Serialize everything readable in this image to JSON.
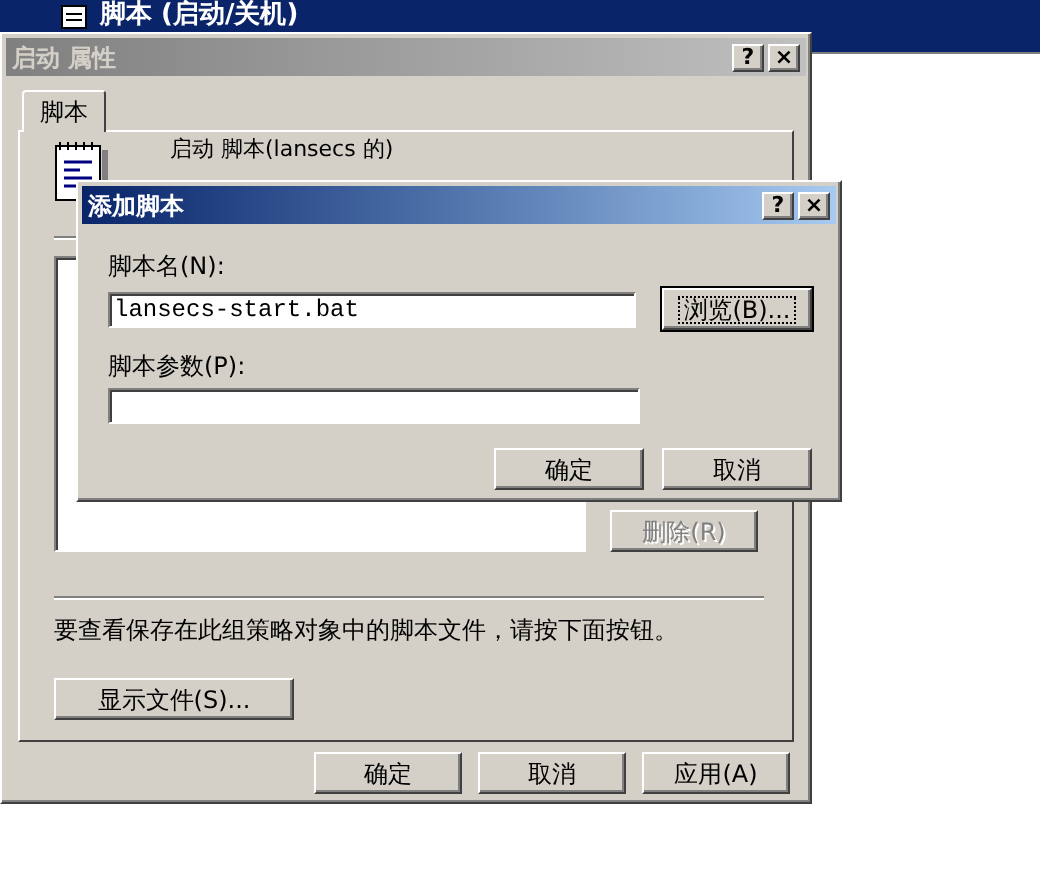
{
  "background_window": {
    "title": "脚本 (启动/关机)"
  },
  "properties_dialog": {
    "title": "启动 属性",
    "active": false,
    "title_buttons": [
      "?",
      "×"
    ],
    "tabs": [
      {
        "label": "脚本",
        "selected": true
      }
    ],
    "heading": "启动 脚本(lansecs 的)",
    "remove_button": {
      "label": "删除(R)",
      "disabled": true
    },
    "hint": "要查看保存在此组策略对象中的脚本文件，请按下面按钮。",
    "show_files_button": "显示文件(S)...",
    "buttons": [
      "确定",
      "取消",
      "应用(A)"
    ]
  },
  "add_script_dialog": {
    "title": "添加脚本",
    "active": true,
    "title_buttons": [
      "?",
      "×"
    ],
    "script_name_label": "脚本名(N):",
    "script_name_value": "lansecs-start.bat",
    "browse_button": {
      "label": "浏览(B)...",
      "focused": true
    },
    "parameters_label": "脚本参数(P):",
    "buttons": [
      "确定",
      "取消"
    ]
  }
}
